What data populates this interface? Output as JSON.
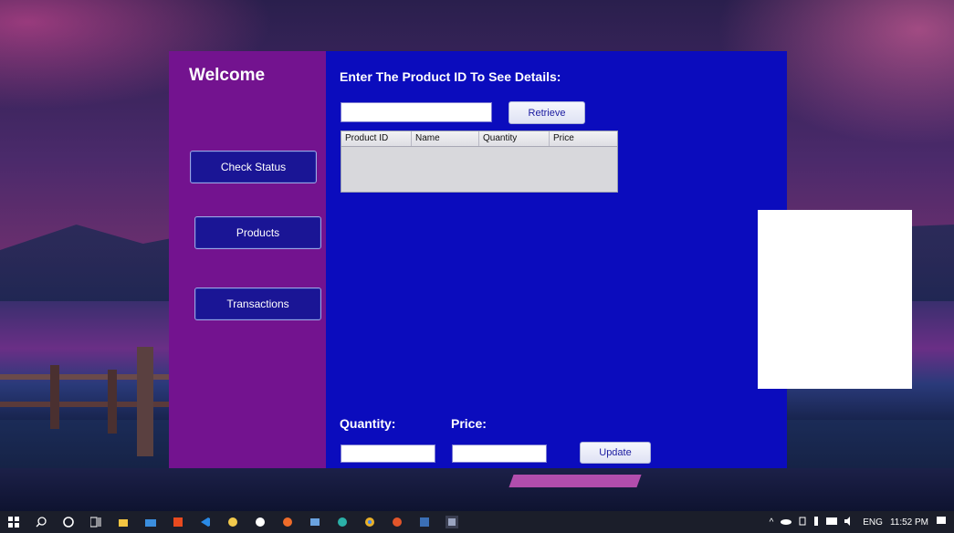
{
  "sidebar": {
    "welcome": "Welcome",
    "buttons": {
      "check_status": "Check Status",
      "products": "Products",
      "transactions": "Transactions"
    }
  },
  "main": {
    "heading": "Enter The Product ID To See Details:",
    "product_id_input_value": "",
    "retrieve_label": "Retrieve",
    "table": {
      "columns": [
        "Product ID",
        "Name",
        "Quantity",
        "Price"
      ],
      "rows": []
    },
    "quantity_label": "Quantity:",
    "price_label": "Price:",
    "quantity_value": "",
    "price_value": "",
    "update_label": "Update"
  },
  "colors": {
    "sidebar_bg": "#73138f",
    "main_bg": "#0b0cbd"
  },
  "taskbar": {
    "icons": [
      "windows-start-icon",
      "search-icon",
      "cortana-icon",
      "task-view-icon",
      "store-icon",
      "mail-icon",
      "office-icon",
      "vscode-icon",
      "app-icon",
      "app-icon",
      "app-icon",
      "app-icon",
      "edge-icon",
      "chrome-icon",
      "app-icon",
      "app-icon",
      "java-icon"
    ],
    "tray": {
      "language": "ENG",
      "time": "11:52 PM"
    }
  }
}
